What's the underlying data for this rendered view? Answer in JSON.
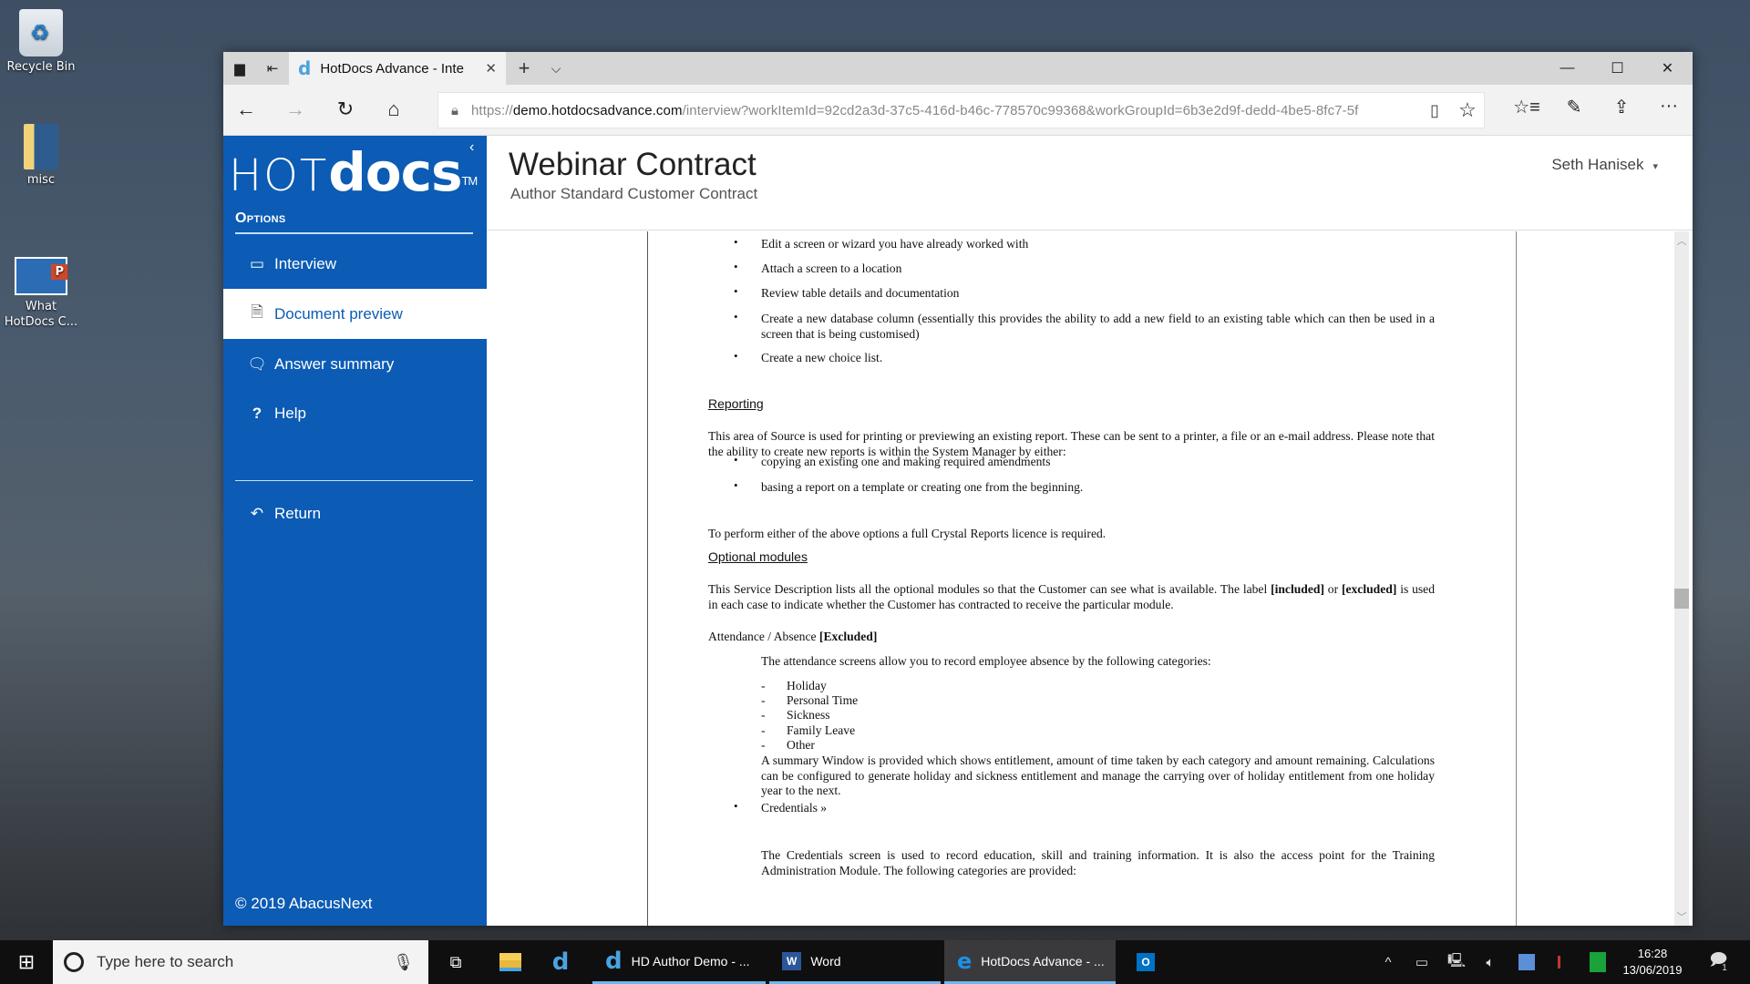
{
  "desktop": {
    "icons": [
      {
        "label": "Recycle Bin",
        "icon": "recycle-bin-icon"
      },
      {
        "label": "misc",
        "icon": "folder-icon"
      },
      {
        "label": "What HotDocs C...",
        "icon": "powerpoint-shortcut-icon"
      }
    ]
  },
  "browser": {
    "tab_title": "HotDocs Advance - Inte",
    "url_prefix": "https://",
    "url_domain": "demo.hotdocsadvance.com",
    "url_path": "/interview?workItemId=92cd2a3d-37c5-416d-b46c-778570c99368&workGroupId=6b3e2d9f-dedd-4be5-8fc7-5f",
    "icons": {
      "set_aside": "▆",
      "tabs_aside": "⇤",
      "new_tab": "+",
      "tab_list": "⌵",
      "close_tab": "✕",
      "minimize": "—",
      "maximize": "☐",
      "close": "✕",
      "back": "←",
      "forward": "→",
      "refresh": "↻",
      "home": "⌂",
      "lock": "🔒︎",
      "reading_view": "▯",
      "favorite": "☆",
      "favorites_hub": "☆≡",
      "notes": "✎",
      "share": "⇪",
      "more": "···"
    }
  },
  "app": {
    "logo_hot": "HOT",
    "logo_docs": "docs",
    "logo_tm": "TM",
    "collapse_icon": "‹",
    "options_heading": "Options",
    "nav": [
      {
        "label": "Interview",
        "icon": "▭",
        "active": false
      },
      {
        "label": "Document preview",
        "icon": "🗎︎",
        "active": true
      },
      {
        "label": "Answer summary",
        "icon": "🗨︎",
        "active": false
      },
      {
        "label": "Help",
        "icon": "?",
        "active": false
      }
    ],
    "return_label": "Return",
    "return_icon": "↶",
    "copyright": "© 2019 AbacusNext",
    "title": "Webinar Contract",
    "subtitle": "Author Standard Customer Contract",
    "user_name": "Seth Hanisek",
    "user_caret": "▾"
  },
  "document": {
    "bullet_char": "•",
    "dash_char": "-",
    "bullets_top": [
      "Edit a screen or wizard you have already worked with",
      "Attach a screen to a location",
      "Review table details and documentation",
      "Create a new database column (essentially this provides the ability to add a new field to an existing table which can then be used in a screen that is being customised)",
      "Create a new choice list."
    ],
    "reporting_heading": "Reporting",
    "reporting_para": "This area of Source is used for printing or previewing an existing report. These can be sent to a printer, a file or an e-mail address. Please note that the ability to create new reports is within the System Manager by either:",
    "reporting_bullets": [
      "copying an existing one and making required amendments",
      "basing a report on a template or creating one from the beginning."
    ],
    "crystal_para": "To perform either of the above options a full Crystal Reports licence is required.",
    "optional_heading": "Optional modules",
    "optional_para_a": "This Service Description lists all the optional modules so that the Customer can see what is available. The label ",
    "optional_included": "[included]",
    "optional_or": " or ",
    "optional_excluded": "[excluded]",
    "optional_para_b": " is used in each case to indicate whether the Customer has contracted to receive the particular module.",
    "attendance_label": "Attendance / Absence ",
    "attendance_status": "[Excluded]",
    "attendance_intro": "The attendance screens allow you to record employee absence by the following categories:",
    "attendance_categories": [
      "Holiday",
      "Personal Time",
      "Sickness",
      "Family Leave",
      "Other"
    ],
    "attendance_summary": "A summary Window is provided which shows entitlement, amount of time taken by each category and amount remaining. Calculations can be configured to generate holiday and sickness entitlement and manage the carrying over of holiday entitlement from one holiday year to the next.",
    "credentials_bullet": "Credentials »",
    "credentials_para": "The Credentials screen is used to record education, skill and training information. It is also the access point for the Training Administration Module. The following categories are provided:"
  },
  "scrollbar": {
    "up": "︿",
    "down": "﹀",
    "position_fraction": 0.4
  },
  "taskbar": {
    "start_icon": "⊞",
    "search_placeholder": "Type here to search",
    "mic_icon": "🎙︎",
    "task_view_icon": "⧉",
    "apps": [
      {
        "label": "HD Author Demo - ...",
        "icon": "hotdocs-author"
      },
      {
        "label": "Word",
        "icon": "word"
      },
      {
        "label": "HotDocs Advance - ...",
        "icon": "edge",
        "active": true
      }
    ],
    "word_badge": "W",
    "outlook_badge": "O",
    "edge_glyph": "e",
    "hotdocs_glyph": "d",
    "tray_chevron": "^",
    "time": "16:28",
    "date": "13/06/2019",
    "notifications_count": "1"
  }
}
